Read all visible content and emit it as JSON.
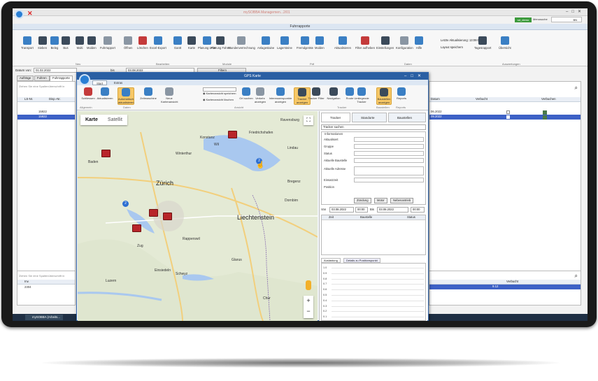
{
  "app": {
    "version_text": "mySOBBA Managemen...2/01",
    "status_pill": "sd_demo",
    "menu_search_label": "Menusuche",
    "search_value": "BN"
  },
  "main": {
    "ribbon_title": "Fuhrrapporte",
    "ribbon_items": [
      "Transport",
      "Sieben",
      "Beleg",
      "Bus",
      "Multi",
      "Mulden",
      "Fuhrrapport",
      "Öffnen",
      "Löschen",
      "Excel-Export",
      "Gantt",
      "Karte",
      "Planung LKW",
      "Planung Fahrer",
      "Stundenverrechnung",
      "Anlagestaine",
      "Lagersteine",
      "Fremdgeräte",
      "Mulden",
      "Aktualisieren",
      "Filter aufheben",
      "Einstellungen",
      "Konfiguration",
      "Hilfe",
      "Tagesrapport",
      "Übersicht"
    ],
    "ribbon_groups": [
      "Neu",
      "Bearbeiten",
      "Module",
      "Pdf",
      "Daten",
      "Auswertungen"
    ],
    "last_update_label": "Letzte Aktualisierung: 13:09:08",
    "layout_save_label": "Layout speichern",
    "filter": {
      "date_from_label": "Datum von:",
      "date_from_value": "01.02.2022",
      "to_label": "bis",
      "to_value": "03.08.2022",
      "filter_button": "Filtern"
    },
    "tabs": [
      "Aufträge",
      "Fuhren",
      "Fuhrrapporte"
    ],
    "group_hint": "Ziehen Sie eine Spaltenüberschrift in",
    "columns_left": [
      "LS-Nr.",
      "Disp.-Nr."
    ],
    "rows_left": [
      {
        "ls": "15922",
        "disp": ""
      },
      {
        "ls": "15922",
        "disp": ""
      }
    ],
    "columns_right": [
      "Datum",
      "Verbucht",
      "Verbuchen"
    ],
    "right_rows": [
      {
        "date": "06.2022"
      },
      {
        "date": "09.2022"
      }
    ],
    "bottom_hint": "Ziehen Sie eine Spaltenüberschrift in",
    "bottom_col": "Inv.",
    "bottom_value": "2304",
    "bottom_right_col": "Verbucht",
    "bottom_right_value": "9.12"
  },
  "gps": {
    "title": "GPS Karte",
    "tabs": [
      "Start",
      "Extras"
    ],
    "ribbon_items": [
      "Schliessen",
      "Aktualisieren",
      "Automatisch aktualisieren",
      "Zeitmaschine",
      "Neue Kartenansicht",
      "Kartenansicht speichern",
      "Kartenansicht löschen",
      "Ort suchen",
      "Verkehr anzeigen",
      "Interessenspunkte anzeigen",
      "Tracker anzeigen",
      "Tracker Filter",
      "Navigation",
      "Route",
      "Umliegende Tracker",
      "Baustellen anzeigen",
      "Reports"
    ],
    "ribbon_groups": [
      "Allgemein",
      "Daten",
      "Ansicht",
      "Tracker",
      "Baustellen",
      "Reports"
    ],
    "map_toggle": [
      "Karte",
      "Satellit"
    ],
    "cities": [
      "Zürich",
      "Liechtenstein",
      "Winterthur",
      "Bregenz",
      "Dornbirn",
      "Rapperswil",
      "Glarus",
      "Chur",
      "Einsiedeln",
      "Ravensburg",
      "Lindau",
      "Friedrichshafen",
      "Konstanz",
      "Baden",
      "Wil",
      "Zug",
      "Luzern",
      "Schwyz"
    ],
    "right_tabs": [
      "Tracker",
      "Standorte",
      "Baustellen"
    ],
    "tracker_search": "Tracker suchen",
    "info_title": "Informationen",
    "info_fields": [
      "Aktualisiert",
      "Gruppe",
      "Status",
      "Aktuelle Baustelle",
      "Aktuelle Adresse",
      "Einsatzzeit",
      "Position"
    ],
    "info_buttons": [
      "Zündung",
      "Motor",
      "Nebenantrieb"
    ],
    "von_label": "Von",
    "von_date": "03.08.2022",
    "von_time": "00:00",
    "bis_label": "Bis",
    "bis_date": "03.08.2022",
    "bis_time": "00:00",
    "hist_cols": [
      "Zeit",
      "Baustelle",
      "Status"
    ],
    "chart_tabs": [
      "Auslastung",
      "Details zu Positionspunkt"
    ],
    "chart_yticks": [
      "1.0",
      "0.9",
      "0.8",
      "0.7",
      "0.6",
      "0.5",
      "0.4",
      "0.3",
      "0.2",
      "0.1"
    ]
  },
  "taskbar": {
    "item": "mySOBBA (Arbeits..."
  }
}
